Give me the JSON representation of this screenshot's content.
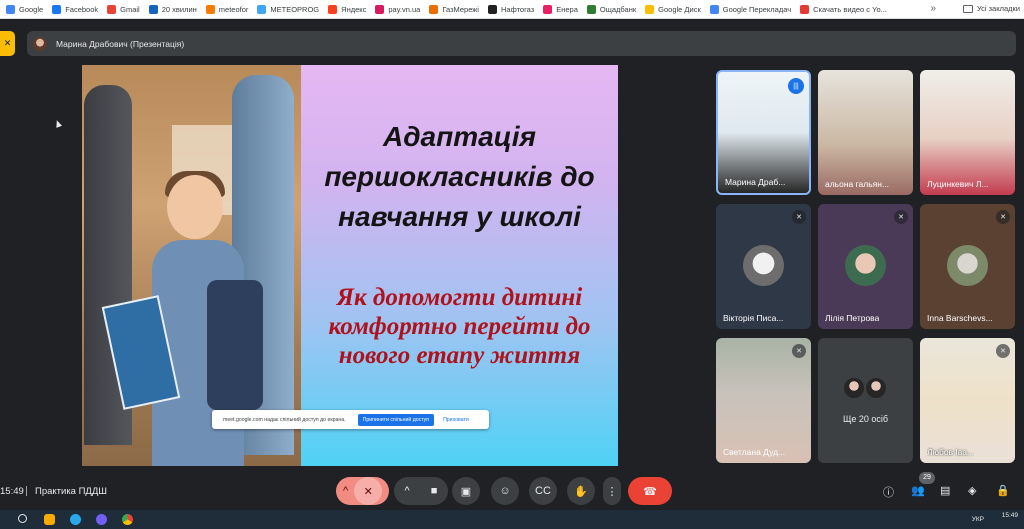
{
  "bookmarks": {
    "items": [
      {
        "label": "Google",
        "color": "#4285f4"
      },
      {
        "label": "Facebook",
        "color": "#1877f2"
      },
      {
        "label": "Gmail",
        "color": "#ea4335"
      },
      {
        "label": "20 хвилин",
        "color": "#1565c0"
      },
      {
        "label": "meteofor",
        "color": "#f57c00"
      },
      {
        "label": "METEOPROG",
        "color": "#42a5f5"
      },
      {
        "label": "Яндекс",
        "color": "#fc3f1d"
      },
      {
        "label": "pay.vn.ua",
        "color": "#d81b60"
      },
      {
        "label": "ГазМережі",
        "color": "#ef6c00"
      },
      {
        "label": "Нафтогаз",
        "color": "#212121"
      },
      {
        "label": "Енера",
        "color": "#e91e63"
      },
      {
        "label": "Ощадбанк",
        "color": "#2e7d32"
      },
      {
        "label": "Google Диск",
        "color": "#fbbc04"
      },
      {
        "label": "Google Перекладач",
        "color": "#4285f4"
      },
      {
        "label": "Скачать видео с Yo...",
        "color": "#e53935"
      }
    ],
    "more": "»",
    "all_bookmarks": "Усі закладки"
  },
  "presenter_banner": {
    "label": "Марина Драбович (Презентація)"
  },
  "slide": {
    "title": "Адаптація першокласників до навчання у школі",
    "subtitle": "Як допомогти дитині комфортно перейти до нового етапу життя"
  },
  "share_prompt": {
    "text": "meet.google.com надає спільний доступ до екрана.",
    "stop_label": "Припинити спільний доступ",
    "hide_label": "Приховати"
  },
  "participants": [
    {
      "name": "Марина Драб...",
      "speaking": true
    },
    {
      "name": "альона гальян...",
      "muted": false
    },
    {
      "name": "Луцинкевич Л...",
      "muted": false
    },
    {
      "name": "Вікторія Писа...",
      "muted": true
    },
    {
      "name": "Лілія Петрова",
      "muted": true
    },
    {
      "name": "Inna Barschevs...",
      "muted": true
    },
    {
      "name": "Светлана Дуд...",
      "muted": true
    },
    {
      "name": "Ще 20 осіб"
    },
    {
      "name": "Любов Іва...",
      "muted": true
    }
  ],
  "controls": {
    "time": "15:49",
    "meeting_name": "Практика ПДДШ",
    "participant_count": "29"
  },
  "taskbar": {
    "lang": "УКР",
    "clock": "15:49"
  }
}
